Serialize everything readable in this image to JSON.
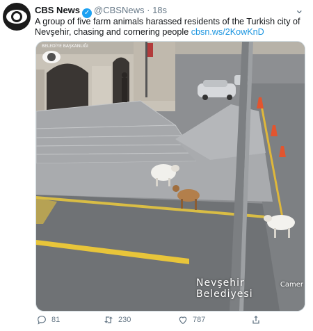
{
  "author": {
    "name": "CBS News",
    "handle": "@CBSNews",
    "separator": "·",
    "time": "18s",
    "avatar_icon": "cbs-eye-logo",
    "verified_icon": "verified-badge-icon",
    "verified_color": "#1da1f2"
  },
  "tweet": {
    "text": "A group of five farm animals harassed residents of the Turkish city of Nevşehir, chasing and cornering people",
    "link": "cbsn.ws/2KowKnD"
  },
  "media": {
    "sign_text": "BELEDİYE BAŞKANLIĞI",
    "watermark": "Nevşehir Belediyesi",
    "camera_label": "Camer"
  },
  "actions": {
    "reply_count": "81",
    "retweet_count": "230",
    "like_count": "787"
  },
  "colors": {
    "link": "#1b95e0",
    "secondary_text": "#657786"
  }
}
